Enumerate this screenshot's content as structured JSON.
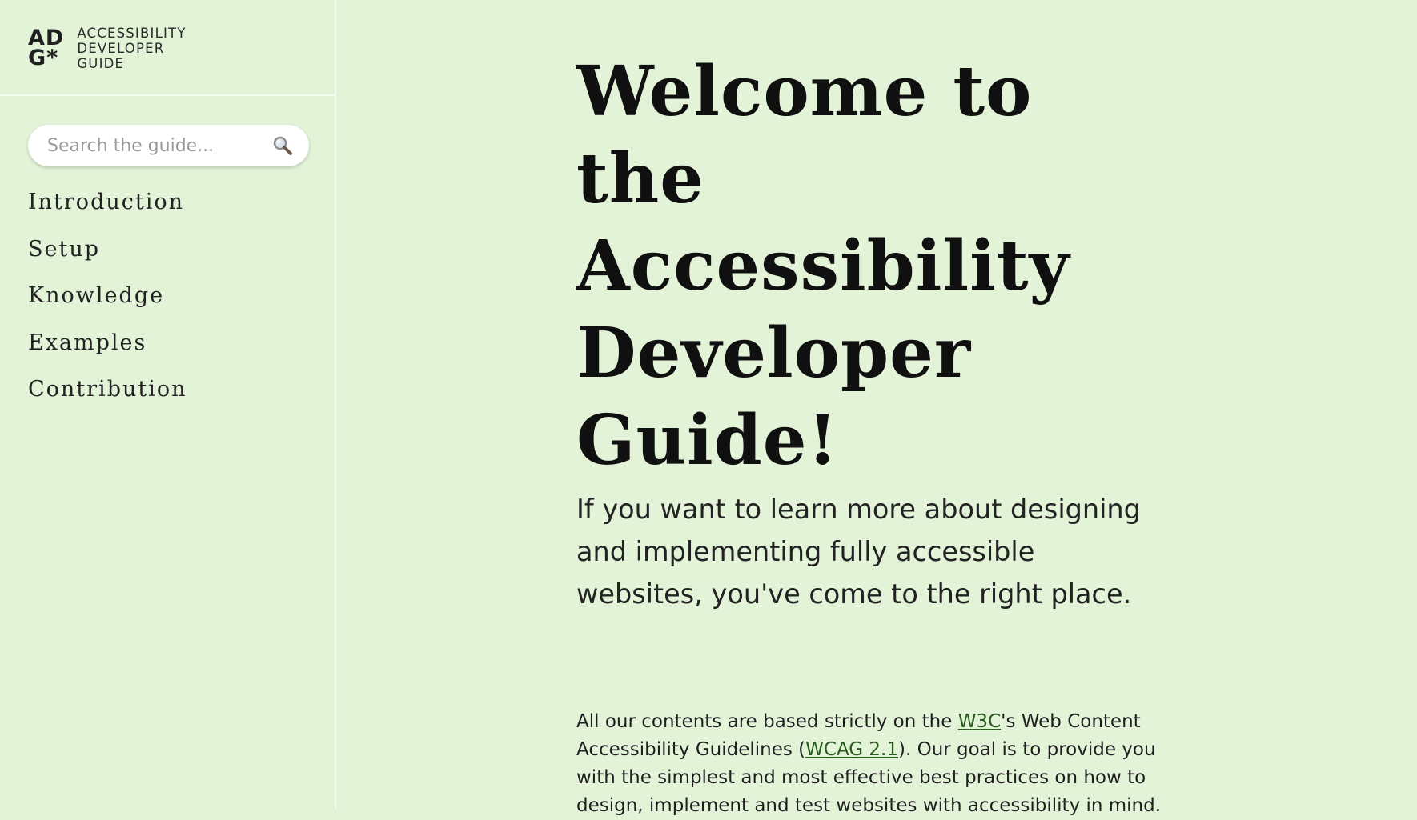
{
  "brand": {
    "mark_line1": "AD",
    "mark_line2": "G*",
    "words": [
      "ACCESSIBILITY",
      "DEVELOPER",
      "GUIDE"
    ]
  },
  "search": {
    "placeholder": "Search the guide...",
    "value": "",
    "icon": "search-icon"
  },
  "nav": {
    "items": [
      {
        "label": "Introduction"
      },
      {
        "label": "Setup"
      },
      {
        "label": "Knowledge"
      },
      {
        "label": "Examples"
      },
      {
        "label": "Contribution"
      }
    ]
  },
  "main": {
    "title": "Welcome to the Accessibility Developer Guide!",
    "lead": "If you want to learn more about designing and implementing fully accessible websites, you've come to the right place.",
    "body": {
      "part1": "All our contents are based strictly on the ",
      "link1": "W3C",
      "part2": "'s Web Content Accessibility Guidelines (",
      "link2": "WCAG 2.1",
      "part3": "). Our goal is to provide you with the simplest and most effective best practices on how to design, implement and test websites with accessibility in mind."
    }
  },
  "colors": {
    "background": "#e2f3d8",
    "link": "#2a5a1e"
  }
}
